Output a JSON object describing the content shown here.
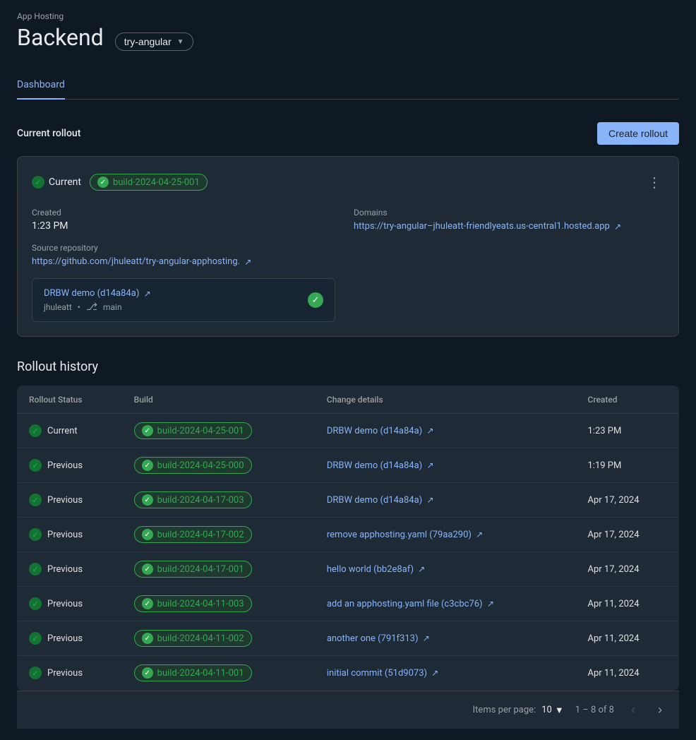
{
  "app": {
    "hosting_label": "App Hosting",
    "backend_title": "Backend",
    "branch_selector": "try-angular"
  },
  "tabs": [
    {
      "id": "dashboard",
      "label": "Dashboard",
      "active": true
    }
  ],
  "current_rollout": {
    "section_title": "Current rollout",
    "create_button": "Create rollout",
    "status_label": "Current",
    "build_id": "build-2024-04-25-001",
    "more_options_label": "⋮",
    "created_label": "Created",
    "created_value": "1:23 PM",
    "source_repo_label": "Source repository",
    "source_repo_url": "https://github.com/jhuleatt/try-angular-apphosting.",
    "domains_label": "Domains",
    "domains_url": "https://try-angular–jhuleatt-friendlyeats.us-central1.hosted.app",
    "commit_link": "DRBW demo (d14a84a)",
    "commit_author": "jhuleatt",
    "commit_branch": "main"
  },
  "rollout_history": {
    "title": "Rollout history",
    "columns": {
      "status": "Rollout Status",
      "build": "Build",
      "change": "Change details",
      "created": "Created"
    },
    "rows": [
      {
        "status": "Current",
        "build": "build-2024-04-25-001",
        "change_link": "DRBW demo (d14a84a)",
        "created": "1:23 PM"
      },
      {
        "status": "Previous",
        "build": "build-2024-04-25-000",
        "change_link": "DRBW demo (d14a84a)",
        "created": "1:19 PM"
      },
      {
        "status": "Previous",
        "build": "build-2024-04-17-003",
        "change_link": "DRBW demo (d14a84a)",
        "created": "Apr 17, 2024"
      },
      {
        "status": "Previous",
        "build": "build-2024-04-17-002",
        "change_link": "remove apphosting.yaml (79aa290)",
        "created": "Apr 17, 2024"
      },
      {
        "status": "Previous",
        "build": "build-2024-04-17-001",
        "change_link": "hello world (bb2e8af)",
        "created": "Apr 17, 2024"
      },
      {
        "status": "Previous",
        "build": "build-2024-04-11-003",
        "change_link": "add an apphosting.yaml file (c3cbc76)",
        "created": "Apr 11, 2024"
      },
      {
        "status": "Previous",
        "build": "build-2024-04-11-002",
        "change_link": "another one (791f313)",
        "created": "Apr 11, 2024"
      },
      {
        "status": "Previous",
        "build": "build-2024-04-11-001",
        "change_link": "initial commit (51d9073)",
        "created": "Apr 11, 2024"
      }
    ],
    "pagination": {
      "items_per_page_label": "Items per page:",
      "items_per_page_value": "10",
      "page_range": "1 – 8 of 8"
    }
  }
}
